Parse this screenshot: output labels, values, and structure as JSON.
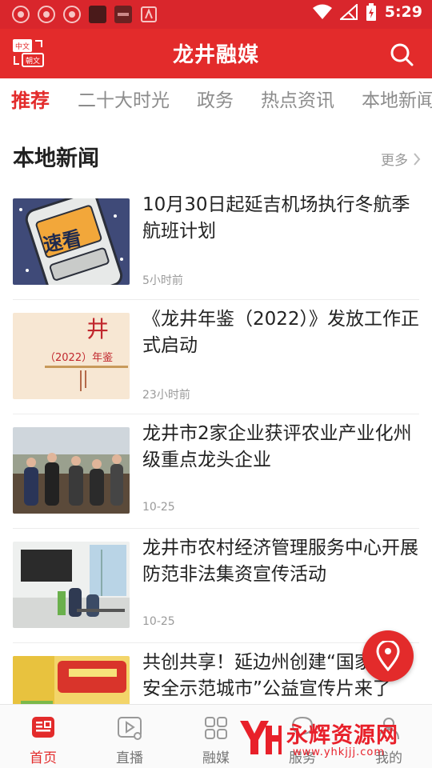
{
  "status_bar": {
    "time": "5:29"
  },
  "app_bar": {
    "title": "龙井融媒",
    "lang_badge": {
      "top": "中文",
      "bottom": "朝文"
    }
  },
  "tabs": [
    {
      "label": "推荐",
      "active": true
    },
    {
      "label": "二十大时光",
      "active": false
    },
    {
      "label": "政务",
      "active": false
    },
    {
      "label": "热点资讯",
      "active": false
    },
    {
      "label": "本地新闻",
      "active": false
    }
  ],
  "section": {
    "title": "本地新闻",
    "more": "更多"
  },
  "news": [
    {
      "title": "10月30日起延吉机场执行冬航季航班计划",
      "time": "5小时前",
      "thumb": "speed-read-phone-illustration",
      "thumb_text": "速看"
    },
    {
      "title": "《龙井年鉴（2022）》发放工作正式启动",
      "time": "23小时前",
      "thumb": "yearbook-cover",
      "thumb_text": "（2022）年鉴"
    },
    {
      "title": "龙井市2家企业获评农业产业化州级重点龙头企业",
      "time": "10-25",
      "thumb": "officials-outdoor-photo"
    },
    {
      "title": "龙井市农村经济管理服务中心开展防范非法集资宣传活动",
      "time": "10-25",
      "thumb": "office-hall-photo"
    },
    {
      "title": "共创共享！延边州创建“国家食品安全示范城市”公益宣传片来了",
      "time": "",
      "thumb": "food-products-photo"
    }
  ],
  "bottom_nav": [
    {
      "label": "首页",
      "icon": "news-home-icon",
      "active": true
    },
    {
      "label": "直播",
      "icon": "live-video-icon",
      "active": false
    },
    {
      "label": "融媒",
      "icon": "grid-icon",
      "active": false
    },
    {
      "label": "服务",
      "icon": "service-icon",
      "active": false
    },
    {
      "label": "我的",
      "icon": "profile-icon",
      "active": false
    }
  ],
  "watermark": {
    "title": "永辉资源网",
    "url": "www.yhkjjj.com"
  },
  "colors": {
    "brand_red": "#e32b2b",
    "status_red": "#d9262c",
    "text": "#222222",
    "muted": "#999999"
  }
}
